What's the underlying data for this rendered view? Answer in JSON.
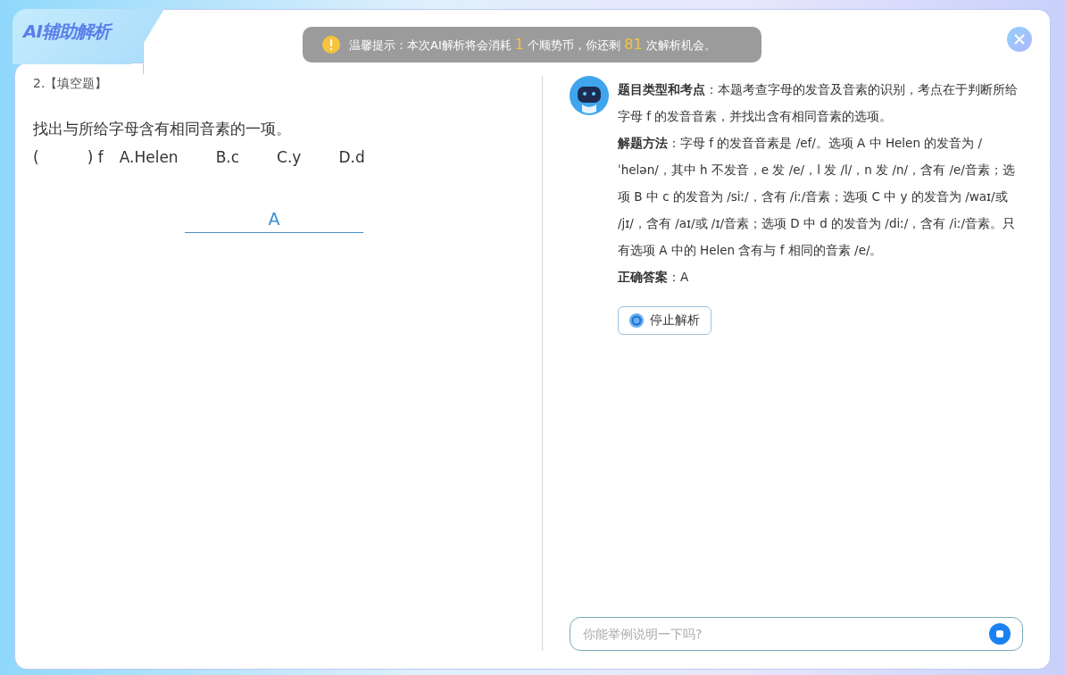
{
  "header": {
    "title": "AI辅助解析"
  },
  "notice": {
    "text": "温馨提示：本次AI解析将会消耗 **1** 个顺势币，你还剩 **81** 次解析机会。"
  },
  "question": {
    "number": "2.【填空题】",
    "prompt": "找出与所给字母含有相同音素的一项。",
    "stem": "(          ) f",
    "options": [
      "A.Helen",
      "B.c",
      "C.y",
      "D.d"
    ],
    "answer": "A"
  },
  "analysis": {
    "paragraphs": [
      "**题目类型和考点**：本题考查字母的发音及音素的识别，考点在于判断所给字母 f 的发音音素，并找出含有相同音素的选项。",
      "**解题方法**：字母 f 的发音音素是 /ef/。选项 A 中 Helen 的发音为 /ˈhelən/，其中 h 不发音，e 发 /e/，l 发 /l/，n 发 /n/，含有 /e/音素；选项 B 中 c 的发音为 /siː/，含有 /iː/音素；选项 C 中 y 的发音为 /waɪ/或 /jɪ/，含有 /aɪ/或 /ɪ/音素；选项 D 中 d 的发音为 /diː/，含有 /iː/音素。只有选项 A 中的 Helen 含有与 f 相同的音素 /e/。",
      "**正确答案**：A"
    ],
    "stop_button": "停止解析"
  },
  "chat": {
    "placeholder": "你能举例说明一下吗?"
  }
}
